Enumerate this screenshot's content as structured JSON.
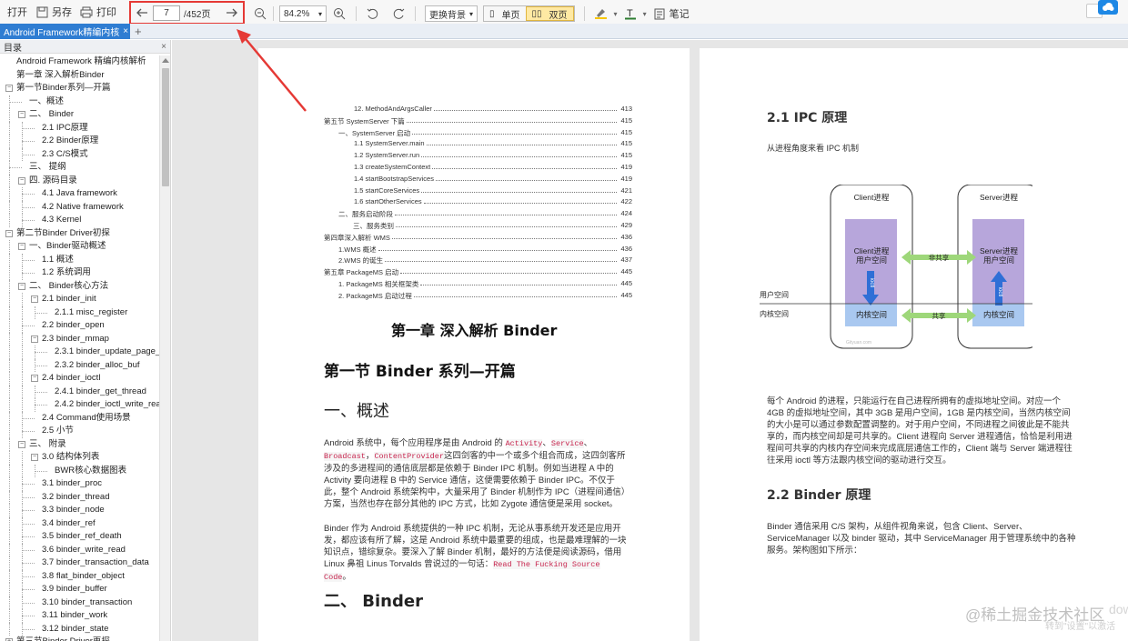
{
  "toolbar": {
    "open": "打开",
    "save_as": "另存",
    "print": "打印",
    "page_current": "7",
    "page_total": "/452页",
    "zoom": "84.2%",
    "background": "更换背景",
    "single_page": "单页",
    "double_page": "双页",
    "notes": "笔记"
  },
  "tabs": [
    {
      "label": "Android Framework精编内核",
      "close": "×"
    }
  ],
  "tab_add": "+",
  "sidebar": {
    "title": "目录",
    "close": "×",
    "items": [
      {
        "label": "Android Framework 精编内核解析",
        "level": 0,
        "toggle": ""
      },
      {
        "label": "第一章 深入解析Binder",
        "level": 0,
        "toggle": ""
      },
      {
        "label": "第一节Binder系列—开篇",
        "level": 0,
        "toggle": "−"
      },
      {
        "label": "一、概述",
        "level": 1,
        "toggle": ""
      },
      {
        "label": "二、 Binder",
        "level": 1,
        "toggle": "−"
      },
      {
        "label": "2.1 IPC原理",
        "level": 2,
        "toggle": ""
      },
      {
        "label": "2.2 Binder原理",
        "level": 2,
        "toggle": ""
      },
      {
        "label": "2.3 C/S模式",
        "level": 2,
        "toggle": ""
      },
      {
        "label": "三、 提纲",
        "level": 1,
        "toggle": ""
      },
      {
        "label": "四. 源码目录",
        "level": 1,
        "toggle": "−"
      },
      {
        "label": "4.1 Java framework",
        "level": 2,
        "toggle": ""
      },
      {
        "label": "4.2 Native framework",
        "level": 2,
        "toggle": ""
      },
      {
        "label": "4.3 Kernel",
        "level": 2,
        "toggle": ""
      },
      {
        "label": "第二节Binder Driver初探",
        "level": 0,
        "toggle": "−"
      },
      {
        "label": "一、Binder驱动概述",
        "level": 1,
        "toggle": "−"
      },
      {
        "label": "1.1 概述",
        "level": 2,
        "toggle": ""
      },
      {
        "label": "1.2 系统调用",
        "level": 2,
        "toggle": ""
      },
      {
        "label": "二、 Binder核心方法",
        "level": 1,
        "toggle": "−"
      },
      {
        "label": "2.1 binder_init",
        "level": 2,
        "toggle": "−"
      },
      {
        "label": "2.1.1 misc_register",
        "level": 3,
        "toggle": ""
      },
      {
        "label": "2.2 binder_open",
        "level": 2,
        "toggle": ""
      },
      {
        "label": "2.3 binder_mmap",
        "level": 2,
        "toggle": "−"
      },
      {
        "label": "2.3.1 binder_update_page_ra",
        "level": 3,
        "toggle": ""
      },
      {
        "label": "2.3.2 binder_alloc_buf",
        "level": 3,
        "toggle": ""
      },
      {
        "label": "2.4 binder_ioctl",
        "level": 2,
        "toggle": "−"
      },
      {
        "label": "2.4.1 binder_get_thread",
        "level": 3,
        "toggle": ""
      },
      {
        "label": "2.4.2 binder_ioctl_write_read",
        "level": 3,
        "toggle": ""
      },
      {
        "label": "2.4 Command使用场景",
        "level": 2,
        "toggle": ""
      },
      {
        "label": "2.5 小节",
        "level": 2,
        "toggle": ""
      },
      {
        "label": "三、 附录",
        "level": 1,
        "toggle": "−"
      },
      {
        "label": "3.0 结构体列表",
        "level": 2,
        "toggle": "−"
      },
      {
        "label": "BWR核心数据图表",
        "level": 3,
        "toggle": ""
      },
      {
        "label": "3.1 binder_proc",
        "level": 2,
        "toggle": ""
      },
      {
        "label": "3.2 binder_thread",
        "level": 2,
        "toggle": ""
      },
      {
        "label": "3.3 binder_node",
        "level": 2,
        "toggle": ""
      },
      {
        "label": "3.4 binder_ref",
        "level": 2,
        "toggle": ""
      },
      {
        "label": "3.5 binder_ref_death",
        "level": 2,
        "toggle": ""
      },
      {
        "label": "3.6 binder_write_read",
        "level": 2,
        "toggle": ""
      },
      {
        "label": "3.7 binder_transaction_data",
        "level": 2,
        "toggle": ""
      },
      {
        "label": "3.8 flat_binder_object",
        "level": 2,
        "toggle": ""
      },
      {
        "label": "3.9 binder_buffer",
        "level": 2,
        "toggle": ""
      },
      {
        "label": "3.10 binder_transaction",
        "level": 2,
        "toggle": ""
      },
      {
        "label": "3.11 binder_work",
        "level": 2,
        "toggle": ""
      },
      {
        "label": "3.12 binder_state",
        "level": 2,
        "toggle": ""
      },
      {
        "label": "第三节Binder Driver再探",
        "level": 0,
        "toggle": "+"
      }
    ]
  },
  "left_page": {
    "toc": [
      {
        "text": "12. MethodAndArgsCaller",
        "page": "413",
        "indent": 3
      },
      {
        "text": "第五节 SystemServer 下篇",
        "page": "415",
        "indent": 0
      },
      {
        "text": "一、SystemServer 启动",
        "page": "415",
        "indent": 1
      },
      {
        "text": "1.1 SystemServer.main",
        "page": "415",
        "indent": 3
      },
      {
        "text": "1.2 SystemServer.run",
        "page": "415",
        "indent": 3
      },
      {
        "text": "1.3 createSystemContext",
        "page": "419",
        "indent": 3
      },
      {
        "text": "1.4 startBootstrapServices",
        "page": "419",
        "indent": 3
      },
      {
        "text": "1.5 startCoreServices",
        "page": "421",
        "indent": 3
      },
      {
        "text": "1.6 startOtherServices",
        "page": "422",
        "indent": 3
      },
      {
        "text": "二、服务启动阶段",
        "page": "424",
        "indent": 1
      },
      {
        "text": "三、服务类别",
        "page": "429",
        "indent": 2
      },
      {
        "text": "第四章深入解析 WMS",
        "page": "436",
        "indent": 0
      },
      {
        "text": "1.WMS 概述",
        "page": "436",
        "indent": 1
      },
      {
        "text": "2.WMS 的诞生",
        "page": "437",
        "indent": 1
      },
      {
        "text": "第五章 PackageMS 启动",
        "page": "445",
        "indent": 0
      },
      {
        "text": "1. PackageMS 相关框架类",
        "page": "445",
        "indent": 1
      },
      {
        "text": "2. PackageMS 启动过程",
        "page": "445",
        "indent": 1
      }
    ],
    "chapter_title": "第一章 深入解析 Binder",
    "section_title": "第一节 Binder 系列—开篇",
    "h_overview": "一、概述",
    "p1_a": "Android 系统中，每个应用程序是由 Android 的",
    "p1_code1": "Activity",
    "p1_sep1": "、",
    "p1_code2": "Service",
    "p1_sep2": "、",
    "p1_code3": "Broadcast",
    "p1_sep3": "，",
    "p1_code4": "ContentProvider",
    "p1_b": "这四剑客的中一个或多个组合而成，这四剑客所涉及的多进程间的通信底层都是依赖于 Binder IPC 机制。例如当进程 A 中的 Activity 要向进程 B 中的 Service 通信，这便需要依赖于 Binder IPC。不仅于此，整个 Android 系统架构中，大量采用了 Binder 机制作为 IPC（进程间通信）方案，当然也存在部分其他的 IPC 方式，比如 Zygote 通信便是采用 socket。",
    "p2_a": "Binder 作为 Android 系统提供的一种 IPC 机制，无论从事系统开发还是应用开发，都应该有所了解，这是 Android 系统中最重要的组成，也是最难理解的一块知识点，错综复杂。要深入了解 Binder 机制，最好的方法便是阅读源码，借用 Linux 鼻祖 Linus Torvalds 曾说过的一句话：",
    "p2_code": "Read The Fucking Source Code",
    "p2_end": "。",
    "h_binder": "二、 Binder"
  },
  "right_page": {
    "h_ipc": "2.1 IPC 原理",
    "ipc_intro": "从进程角度来看 IPC 机制",
    "diagram": {
      "client_title": "Client进程",
      "server_title": "Server进程",
      "client_user": "Client进程\n用户空间",
      "server_user": "Server进程\n用户空间",
      "not_shared": "非共享",
      "shared": "共享",
      "kernel_space_left": "内核空间",
      "kernel_space_right": "内核空间",
      "user_space_label": "用户空间",
      "kernel_space_label": "内核空间",
      "ioctl_left": "ioctl",
      "ioctl_right": "ioctl",
      "watermark": "Gityuan.com"
    },
    "p_ipc": "每个 Android 的进程，只能运行在自己进程所拥有的虚拟地址空间。对应一个 4GB 的虚拟地址空间，其中 3GB 是用户空间，1GB 是内核空间，当然内核空间的大小是可以通过参数配置调整的。对于用户空间，不同进程之间彼此是不能共享的，而内核空间却是可共享的。Client 进程向 Server 进程通信，恰恰是利用进程间可共享的内核内存空间来完成底层通信工作的，Client 端与 Server 端进程往往采用 ioctl 等方法跟内核空间的驱动进行交互。",
    "h_binder_principle": "2.2 Binder 原理",
    "p_binder": "Binder 通信采用 C/S 架构，从组件视角来说，包含 Client、Server、ServiceManager 以及 binder 驱动，其中 ServiceManager 用于管理系统中的各种服务。架构图如下所示："
  },
  "watermarks": {
    "juejin": "@稀土掘金技术社区",
    "activate": "转到\"设置\"以激活",
    "activate2": "dow"
  }
}
